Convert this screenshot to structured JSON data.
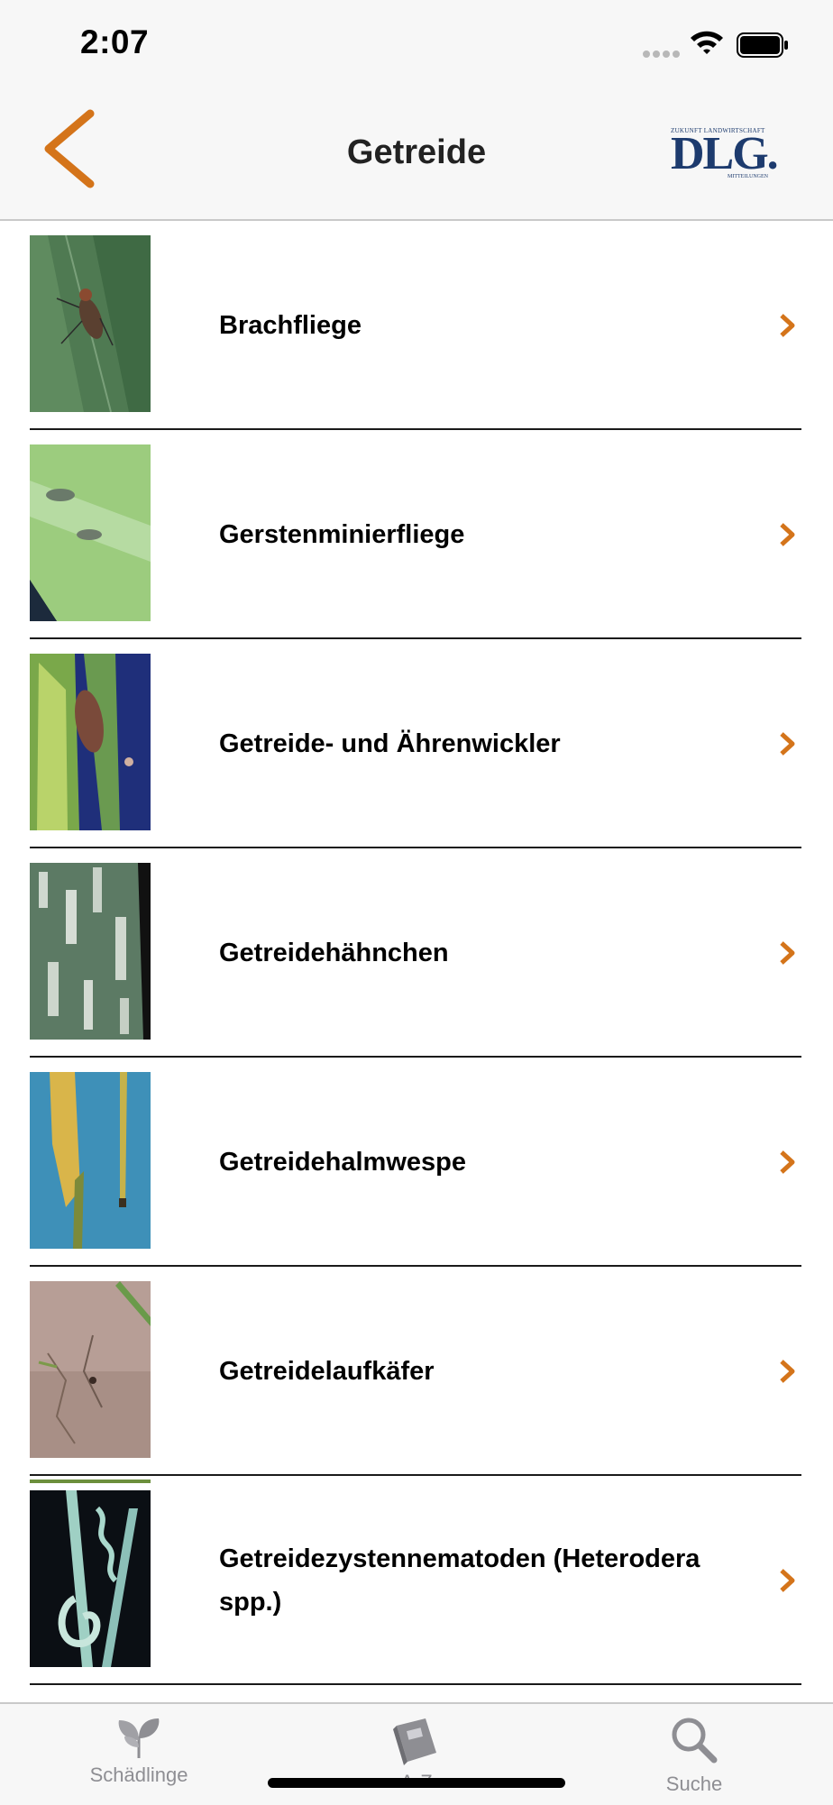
{
  "status": {
    "time": "2:07"
  },
  "nav": {
    "title": "Getreide"
  },
  "logo": {
    "top": "ZUKUNFT LANDWIRTSCHAFT",
    "main": "DLG.",
    "bottom": "MITTEILUNGEN"
  },
  "items": [
    {
      "label": "Brachfliege"
    },
    {
      "label": "Gerstenminierfliege"
    },
    {
      "label": "Getreide- und Ährenwickler"
    },
    {
      "label": "Getreidehähnchen"
    },
    {
      "label": "Getreidehalmwespe"
    },
    {
      "label": "Getreidelaufkäfer"
    },
    {
      "label": "Getreidezystennematoden (Heterodera spp.)"
    }
  ],
  "tabs": [
    {
      "label": "Schädlinge",
      "icon": "seedling-icon"
    },
    {
      "label": "A-Z",
      "icon": "book-icon"
    },
    {
      "label": "Suche",
      "icon": "search-icon"
    }
  ],
  "colors": {
    "accent": "#d4741a",
    "logo": "#1d3b6e",
    "tab_inactive": "#8e8e93"
  }
}
